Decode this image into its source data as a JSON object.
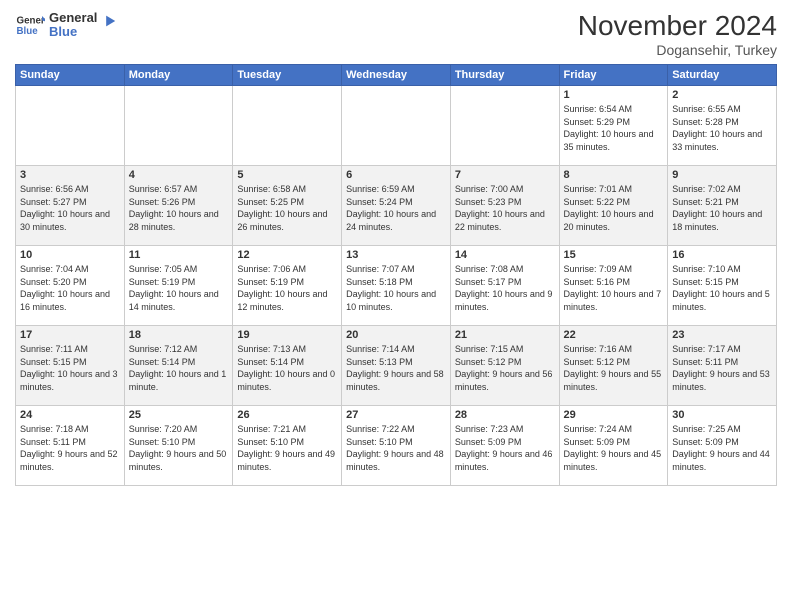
{
  "header": {
    "logo": "GeneralBlue",
    "title": "November 2024",
    "location": "Dogansehir, Turkey"
  },
  "days_of_week": [
    "Sunday",
    "Monday",
    "Tuesday",
    "Wednesday",
    "Thursday",
    "Friday",
    "Saturday"
  ],
  "weeks": [
    [
      {
        "day": "",
        "sunrise": "",
        "sunset": "",
        "daylight": ""
      },
      {
        "day": "",
        "sunrise": "",
        "sunset": "",
        "daylight": ""
      },
      {
        "day": "",
        "sunrise": "",
        "sunset": "",
        "daylight": ""
      },
      {
        "day": "",
        "sunrise": "",
        "sunset": "",
        "daylight": ""
      },
      {
        "day": "",
        "sunrise": "",
        "sunset": "",
        "daylight": ""
      },
      {
        "day": "1",
        "sunrise": "Sunrise: 6:54 AM",
        "sunset": "Sunset: 5:29 PM",
        "daylight": "Daylight: 10 hours and 35 minutes."
      },
      {
        "day": "2",
        "sunrise": "Sunrise: 6:55 AM",
        "sunset": "Sunset: 5:28 PM",
        "daylight": "Daylight: 10 hours and 33 minutes."
      }
    ],
    [
      {
        "day": "3",
        "sunrise": "Sunrise: 6:56 AM",
        "sunset": "Sunset: 5:27 PM",
        "daylight": "Daylight: 10 hours and 30 minutes."
      },
      {
        "day": "4",
        "sunrise": "Sunrise: 6:57 AM",
        "sunset": "Sunset: 5:26 PM",
        "daylight": "Daylight: 10 hours and 28 minutes."
      },
      {
        "day": "5",
        "sunrise": "Sunrise: 6:58 AM",
        "sunset": "Sunset: 5:25 PM",
        "daylight": "Daylight: 10 hours and 26 minutes."
      },
      {
        "day": "6",
        "sunrise": "Sunrise: 6:59 AM",
        "sunset": "Sunset: 5:24 PM",
        "daylight": "Daylight: 10 hours and 24 minutes."
      },
      {
        "day": "7",
        "sunrise": "Sunrise: 7:00 AM",
        "sunset": "Sunset: 5:23 PM",
        "daylight": "Daylight: 10 hours and 22 minutes."
      },
      {
        "day": "8",
        "sunrise": "Sunrise: 7:01 AM",
        "sunset": "Sunset: 5:22 PM",
        "daylight": "Daylight: 10 hours and 20 minutes."
      },
      {
        "day": "9",
        "sunrise": "Sunrise: 7:02 AM",
        "sunset": "Sunset: 5:21 PM",
        "daylight": "Daylight: 10 hours and 18 minutes."
      }
    ],
    [
      {
        "day": "10",
        "sunrise": "Sunrise: 7:04 AM",
        "sunset": "Sunset: 5:20 PM",
        "daylight": "Daylight: 10 hours and 16 minutes."
      },
      {
        "day": "11",
        "sunrise": "Sunrise: 7:05 AM",
        "sunset": "Sunset: 5:19 PM",
        "daylight": "Daylight: 10 hours and 14 minutes."
      },
      {
        "day": "12",
        "sunrise": "Sunrise: 7:06 AM",
        "sunset": "Sunset: 5:19 PM",
        "daylight": "Daylight: 10 hours and 12 minutes."
      },
      {
        "day": "13",
        "sunrise": "Sunrise: 7:07 AM",
        "sunset": "Sunset: 5:18 PM",
        "daylight": "Daylight: 10 hours and 10 minutes."
      },
      {
        "day": "14",
        "sunrise": "Sunrise: 7:08 AM",
        "sunset": "Sunset: 5:17 PM",
        "daylight": "Daylight: 10 hours and 9 minutes."
      },
      {
        "day": "15",
        "sunrise": "Sunrise: 7:09 AM",
        "sunset": "Sunset: 5:16 PM",
        "daylight": "Daylight: 10 hours and 7 minutes."
      },
      {
        "day": "16",
        "sunrise": "Sunrise: 7:10 AM",
        "sunset": "Sunset: 5:15 PM",
        "daylight": "Daylight: 10 hours and 5 minutes."
      }
    ],
    [
      {
        "day": "17",
        "sunrise": "Sunrise: 7:11 AM",
        "sunset": "Sunset: 5:15 PM",
        "daylight": "Daylight: 10 hours and 3 minutes."
      },
      {
        "day": "18",
        "sunrise": "Sunrise: 7:12 AM",
        "sunset": "Sunset: 5:14 PM",
        "daylight": "Daylight: 10 hours and 1 minute."
      },
      {
        "day": "19",
        "sunrise": "Sunrise: 7:13 AM",
        "sunset": "Sunset: 5:14 PM",
        "daylight": "Daylight: 10 hours and 0 minutes."
      },
      {
        "day": "20",
        "sunrise": "Sunrise: 7:14 AM",
        "sunset": "Sunset: 5:13 PM",
        "daylight": "Daylight: 9 hours and 58 minutes."
      },
      {
        "day": "21",
        "sunrise": "Sunrise: 7:15 AM",
        "sunset": "Sunset: 5:12 PM",
        "daylight": "Daylight: 9 hours and 56 minutes."
      },
      {
        "day": "22",
        "sunrise": "Sunrise: 7:16 AM",
        "sunset": "Sunset: 5:12 PM",
        "daylight": "Daylight: 9 hours and 55 minutes."
      },
      {
        "day": "23",
        "sunrise": "Sunrise: 7:17 AM",
        "sunset": "Sunset: 5:11 PM",
        "daylight": "Daylight: 9 hours and 53 minutes."
      }
    ],
    [
      {
        "day": "24",
        "sunrise": "Sunrise: 7:18 AM",
        "sunset": "Sunset: 5:11 PM",
        "daylight": "Daylight: 9 hours and 52 minutes."
      },
      {
        "day": "25",
        "sunrise": "Sunrise: 7:20 AM",
        "sunset": "Sunset: 5:10 PM",
        "daylight": "Daylight: 9 hours and 50 minutes."
      },
      {
        "day": "26",
        "sunrise": "Sunrise: 7:21 AM",
        "sunset": "Sunset: 5:10 PM",
        "daylight": "Daylight: 9 hours and 49 minutes."
      },
      {
        "day": "27",
        "sunrise": "Sunrise: 7:22 AM",
        "sunset": "Sunset: 5:10 PM",
        "daylight": "Daylight: 9 hours and 48 minutes."
      },
      {
        "day": "28",
        "sunrise": "Sunrise: 7:23 AM",
        "sunset": "Sunset: 5:09 PM",
        "daylight": "Daylight: 9 hours and 46 minutes."
      },
      {
        "day": "29",
        "sunrise": "Sunrise: 7:24 AM",
        "sunset": "Sunset: 5:09 PM",
        "daylight": "Daylight: 9 hours and 45 minutes."
      },
      {
        "day": "30",
        "sunrise": "Sunrise: 7:25 AM",
        "sunset": "Sunset: 5:09 PM",
        "daylight": "Daylight: 9 hours and 44 minutes."
      }
    ]
  ]
}
